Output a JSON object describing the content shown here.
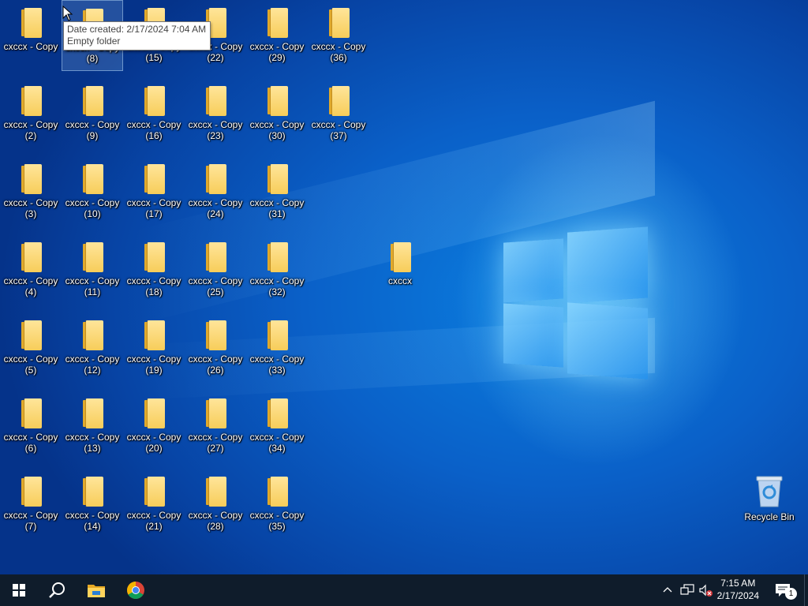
{
  "desktop": {
    "icons": [
      {
        "line1": "cxccx - Copy",
        "line2": ""
      },
      {
        "line1": "cxccx - Copy",
        "line2": "(2)"
      },
      {
        "line1": "cxccx - Copy",
        "line2": "(3)"
      },
      {
        "line1": "cxccx - Copy",
        "line2": "(4)"
      },
      {
        "line1": "cxccx - Copy",
        "line2": "(5)"
      },
      {
        "line1": "cxccx - Copy",
        "line2": "(6)"
      },
      {
        "line1": "cxccx - Copy",
        "line2": "(7)"
      },
      {
        "line1": "cxccx - Copy",
        "line2": "(8)"
      },
      {
        "line1": "cxccx - Copy",
        "line2": "(9)"
      },
      {
        "line1": "cxccx - Copy",
        "line2": "(10)"
      },
      {
        "line1": "cxccx - Copy",
        "line2": "(11)"
      },
      {
        "line1": "cxccx - Copy",
        "line2": "(12)"
      },
      {
        "line1": "cxccx - Copy",
        "line2": "(13)"
      },
      {
        "line1": "cxccx - Copy",
        "line2": "(14)"
      },
      {
        "line1": "cxccx - Copy",
        "line2": "(15)"
      },
      {
        "line1": "cxccx - Copy",
        "line2": "(16)"
      },
      {
        "line1": "cxccx - Copy",
        "line2": "(17)"
      },
      {
        "line1": "cxccx - Copy",
        "line2": "(18)"
      },
      {
        "line1": "cxccx - Copy",
        "line2": "(19)"
      },
      {
        "line1": "cxccx - Copy",
        "line2": "(20)"
      },
      {
        "line1": "cxccx - Copy",
        "line2": "(21)"
      },
      {
        "line1": "cxccx - Copy",
        "line2": "(22)"
      },
      {
        "line1": "cxccx - Copy",
        "line2": "(23)"
      },
      {
        "line1": "cxccx - Copy",
        "line2": "(24)"
      },
      {
        "line1": "cxccx - Copy",
        "line2": "(25)"
      },
      {
        "line1": "cxccx - Copy",
        "line2": "(26)"
      },
      {
        "line1": "cxccx - Copy",
        "line2": "(27)"
      },
      {
        "line1": "cxccx - Copy",
        "line2": "(28)"
      },
      {
        "line1": "cxccx - Copy",
        "line2": "(29)"
      },
      {
        "line1": "cxccx - Copy",
        "line2": "(30)"
      },
      {
        "line1": "cxccx - Copy",
        "line2": "(31)"
      },
      {
        "line1": "cxccx - Copy",
        "line2": "(32)"
      },
      {
        "line1": "cxccx - Copy",
        "line2": "(33)"
      },
      {
        "line1": "cxccx - Copy",
        "line2": "(34)"
      },
      {
        "line1": "cxccx - Copy",
        "line2": "(35)"
      },
      {
        "line1": "cxccx - Copy",
        "line2": "(36)"
      },
      {
        "line1": "cxccx - Copy",
        "line2": "(37)"
      },
      {
        "line1": "cxccx",
        "line2": ""
      }
    ],
    "tooltip": {
      "line1": "Date created: 2/17/2024 7:04 AM",
      "line2": "Empty folder"
    },
    "recycle_bin_label": "Recycle Bin"
  },
  "taskbar": {
    "icons": [
      "windows-start-icon",
      "search-icon",
      "file-explorer-icon",
      "chrome-icon"
    ],
    "clock": {
      "time": "7:15 AM",
      "date": "2/17/2024"
    },
    "notification_count": "1"
  },
  "colors": {
    "taskbar": "#0f1c2b",
    "folder": "#f7cd5a",
    "wallpaper": "#0a60c8"
  }
}
